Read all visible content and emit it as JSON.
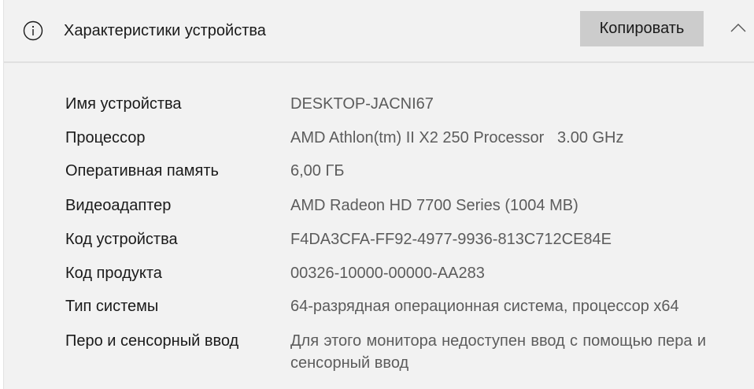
{
  "header": {
    "title": "Характеристики устройства",
    "copy_label": "Копировать"
  },
  "specs": [
    {
      "label": "Имя устройства",
      "value": "DESKTOP-JACNI67"
    },
    {
      "label": "Процессор",
      "value": "AMD Athlon(tm) II X2 250 Processor   3.00 GHz"
    },
    {
      "label": "Оперативная память",
      "value": "6,00 ГБ"
    },
    {
      "label": "Видеоадаптер",
      "value": "AMD Radeon HD 7700 Series (1004 MB)"
    },
    {
      "label": "Код устройства",
      "value": "F4DA3CFA-FF92-4977-9936-813C712CE84E"
    },
    {
      "label": "Код продукта",
      "value": "00326-10000-00000-AA283"
    },
    {
      "label": "Тип системы",
      "value": "64-разрядная операционная система, процессор x64"
    },
    {
      "label": "Перо и сенсорный ввод",
      "value": "Для этого монитора недоступен ввод с помощью пера и сенсорный ввод"
    }
  ]
}
